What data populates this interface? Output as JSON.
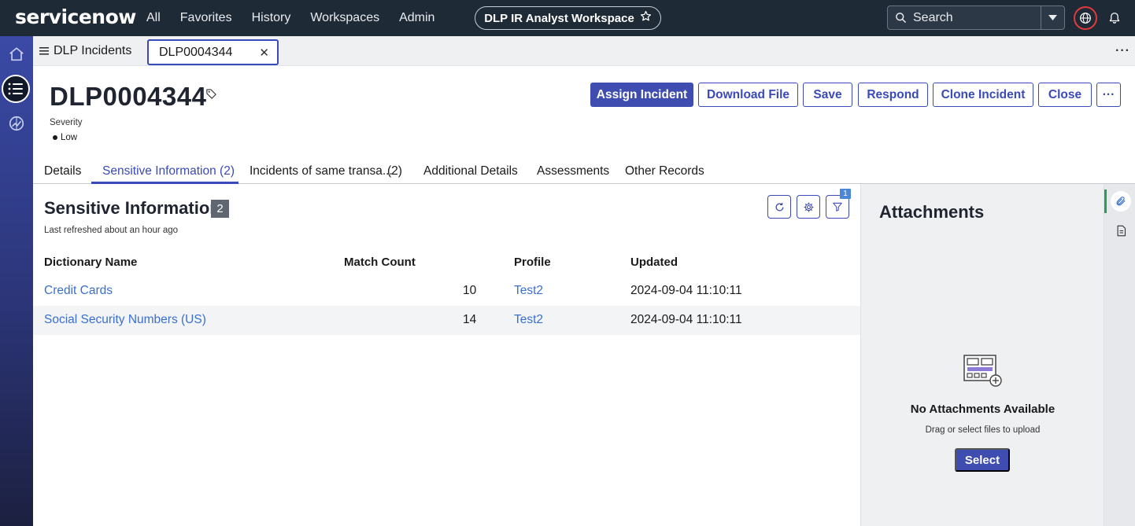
{
  "topnav": {
    "logo": "servicenow",
    "links": [
      "All",
      "Favorites",
      "History",
      "Workspaces",
      "Admin"
    ],
    "workspace_name": "DLP IR Analyst Workspace",
    "search_placeholder": "Search"
  },
  "tabbar": {
    "list_tab_label": "DLP Incidents",
    "record_tab_label": "DLP0004344",
    "more_label": "···"
  },
  "record": {
    "number": "DLP0004344",
    "severity_label": "Severity",
    "severity_value": "Low",
    "actions": {
      "assign": "Assign Incident",
      "download": "Download File",
      "save": "Save",
      "respond": "Respond",
      "clone": "Clone Incident",
      "close": "Close",
      "more": "···"
    }
  },
  "record_tabs": [
    "Details",
    "Sensitive Information (2)",
    "Incidents of same transa...",
    "(2)",
    "Additional Details",
    "Assessments",
    "Other Records"
  ],
  "active_tab_index": 1,
  "sensitive_info": {
    "title": "Sensitive Information",
    "count": "2",
    "last_refreshed": "Last refreshed about an hour ago",
    "filter_badge": "1",
    "columns": [
      "Dictionary Name",
      "Match Count",
      "Profile",
      "Updated"
    ],
    "rows": [
      {
        "dictionary": "Credit Cards",
        "match_count": "10",
        "profile": "Test2",
        "updated": "2024-09-04 11:10:11"
      },
      {
        "dictionary": "Social Security Numbers (US)",
        "match_count": "14",
        "profile": "Test2",
        "updated": "2024-09-04 11:10:11"
      }
    ]
  },
  "attachments": {
    "title": "Attachments",
    "empty_title": "No Attachments Available",
    "empty_hint": "Drag or select files to upload",
    "select_label": "Select"
  },
  "colors": {
    "accent": "#3f4db0",
    "nav_bg": "#1f2a37",
    "link": "#3a6fd0"
  },
  "icons": [
    "home-icon",
    "list-icon",
    "analytics-icon",
    "search-icon",
    "chevron-down-icon",
    "globe-icon",
    "bell-icon",
    "tag-icon",
    "refresh-icon",
    "gear-icon",
    "filter-icon",
    "paperclip-icon",
    "document-icon",
    "star-icon"
  ]
}
